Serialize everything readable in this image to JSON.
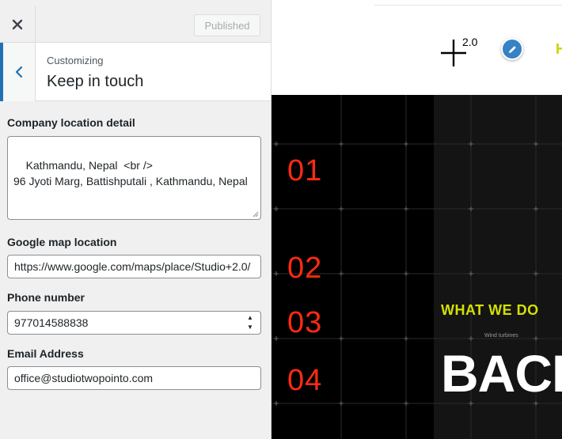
{
  "header": {
    "published_label": "Published"
  },
  "section": {
    "customizing_label": "Customizing",
    "title": "Keep in touch"
  },
  "fields": {
    "company_location": {
      "label": "Company location detail",
      "value": "Kathmandu, Nepal  <br />\n96 Jyoti Marg, Battishputali , Kathmandu, Nepal"
    },
    "google_map": {
      "label": "Google map location",
      "value": "https://www.google.com/maps/place/Studio+2.0/"
    },
    "phone": {
      "label": "Phone number",
      "value": "977014588838"
    },
    "email": {
      "label": "Email Address",
      "value": "office@studiotwopointo.com"
    }
  },
  "preview": {
    "logo_superscript": "2.0",
    "nav_letter": "H",
    "numbers": [
      "01",
      "02",
      "03",
      "04"
    ],
    "heading": "WHAT WE DO",
    "small_caption": "Wind turbines",
    "tiny_caption": "",
    "big_word": "BACK"
  },
  "colors": {
    "accent_blue": "#2271b1",
    "edit_button_blue": "#3582c4",
    "number_red": "#ff2a12",
    "heading_yellow": "#d4e000"
  },
  "icons": {
    "close": "close-icon",
    "back": "chevron-left-icon",
    "edit": "pencil-icon",
    "spinner_up": "caret-up-icon",
    "spinner_down": "caret-down-icon"
  }
}
